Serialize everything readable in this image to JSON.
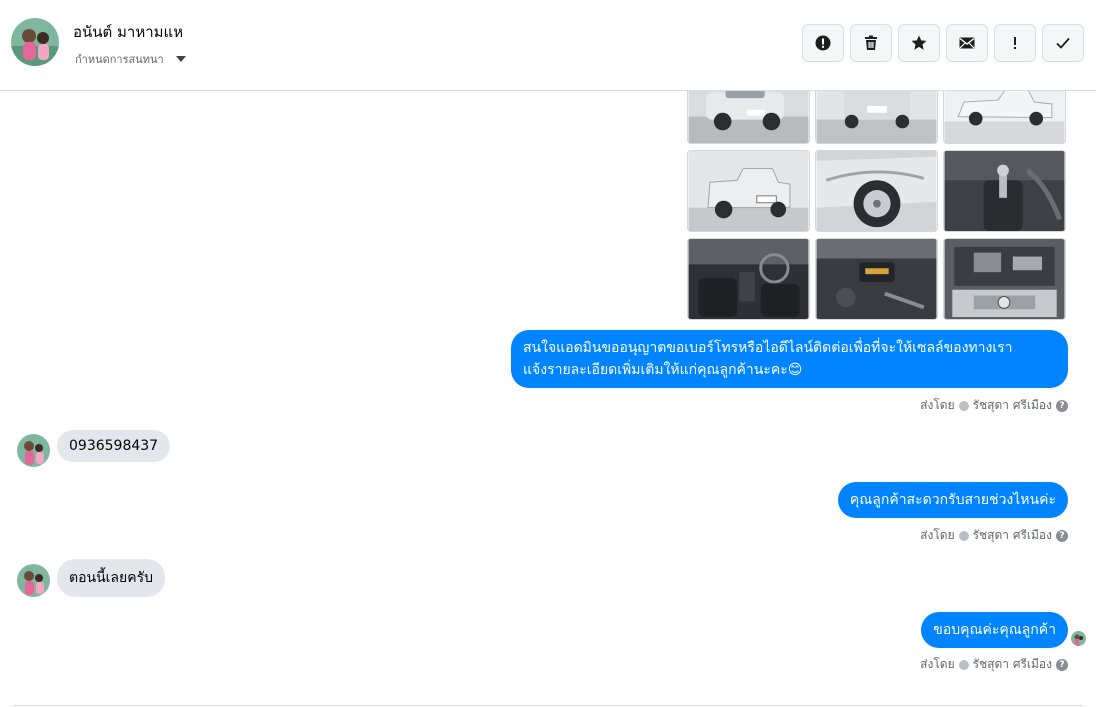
{
  "header": {
    "contact_name": "อนันต์ มาหามแห",
    "status_label": "กำหนดการสนทนา",
    "actions": [
      {
        "icon": "alert-circle-icon",
        "label": "Mark as spam"
      },
      {
        "icon": "trash-icon",
        "label": "Delete"
      },
      {
        "icon": "star-icon",
        "label": "Star"
      },
      {
        "icon": "mail-icon",
        "label": "Mark as unread"
      },
      {
        "icon": "exclamation-icon",
        "label": "Follow up"
      },
      {
        "icon": "check-icon",
        "label": "Done"
      }
    ]
  },
  "photos": [
    {
      "name": "pickup-front-left",
      "color": "#cfd3d6"
    },
    {
      "name": "pickup-rear",
      "color": "#c9cdd0"
    },
    {
      "name": "pickup-side",
      "color": "#e8eaec"
    },
    {
      "name": "pickup-rear-left",
      "color": "#d3d6d9"
    },
    {
      "name": "wheel-closeup",
      "color": "#bfc3c6"
    },
    {
      "name": "interior-gear",
      "color": "#4a4d52"
    },
    {
      "name": "interior-dashboard",
      "color": "#3b3e44"
    },
    {
      "name": "interior-console",
      "color": "#45484d"
    },
    {
      "name": "engine-bay",
      "color": "#6b6e73"
    }
  ],
  "messages": [
    {
      "direction": "out",
      "lines": [
        "สนใจแอดมินขออนุญาตขอเบอร์โทรหรือไอดีไลน์ติดต่อเพื่อที่จะให้เซลล์ของทางเรา",
        "แจ้งรายละเอียดเพิ่มเติมให้แก่คุณลูกค้านะคะ😊"
      ]
    },
    {
      "direction": "in",
      "text": "0936598437"
    },
    {
      "direction": "out",
      "text": "คุณลูกค้าสะดวกรับสายช่วงไหนค่ะ"
    },
    {
      "direction": "in",
      "text": "ตอนนี้เลยครับ"
    },
    {
      "direction": "out",
      "text": "ขอบคุณค่ะคุณลูกค้า"
    }
  ],
  "sent_meta": {
    "prefix": "ส่งโดย",
    "sender": "รัชสุดา ศรีเมือง",
    "help": "?"
  },
  "colors": {
    "outgoing_bubble": "#0084ff",
    "incoming_bubble": "#e4e6eb"
  }
}
